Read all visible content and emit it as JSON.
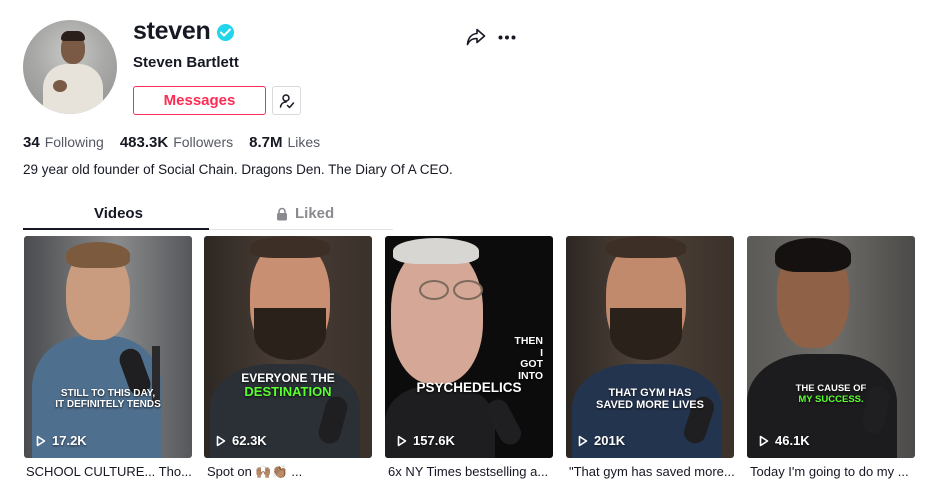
{
  "profile": {
    "username": "steven",
    "nickname": "Steven Bartlett",
    "messages_label": "Messages",
    "bio": "29 year old founder of Social Chain. Dragons Den. The Diary Of A CEO."
  },
  "stats": {
    "following": {
      "value": "34",
      "label": "Following"
    },
    "followers": {
      "value": "483.3K",
      "label": "Followers"
    },
    "likes": {
      "value": "8.7M",
      "label": "Likes"
    }
  },
  "tabs": [
    {
      "label": "Videos",
      "active": true
    },
    {
      "label": "Liked",
      "active": false,
      "icon": "lock-icon"
    }
  ],
  "videos": [
    {
      "plays": "17.2K",
      "title": "SCHOOL CULTURE... Tho...",
      "caption_lines": [
        "STILL TO THIS DAY,",
        "IT DEFINITELY TENDS"
      ],
      "caption_highlight": ""
    },
    {
      "plays": "62.3K",
      "title": "Spot on 🙌🏽👏🏽 ...",
      "caption_lines": [
        "EVERYONE THE"
      ],
      "caption_highlight": "DESTINATION"
    },
    {
      "plays": "157.6K",
      "title": "6x NY Times bestselling a...",
      "caption_lines": [
        "THEN",
        "I",
        "GOT",
        "INTO"
      ],
      "caption_highlight": "PSYCHEDELICS"
    },
    {
      "plays": "201K",
      "title": "\"That gym has saved more...",
      "caption_lines": [
        "THAT GYM HAS",
        "SAVED MORE LIVES"
      ],
      "caption_highlight": ""
    },
    {
      "plays": "46.1K",
      "title": "Today I'm going to do my ...",
      "caption_lines": [
        "THE CAUSE OF"
      ],
      "caption_highlight": "MY SUCCESS."
    }
  ],
  "colors": {
    "accent": "#fe2c55",
    "verified": "#20d5ec",
    "caption_highlight": "#5bff2e"
  },
  "icons": {
    "verified": "verified-badge-icon",
    "follow": "person-check-icon",
    "share": "share-arrow-icon",
    "more": "more-horizontal-icon",
    "play": "play-outline-icon",
    "lock": "lock-icon"
  }
}
